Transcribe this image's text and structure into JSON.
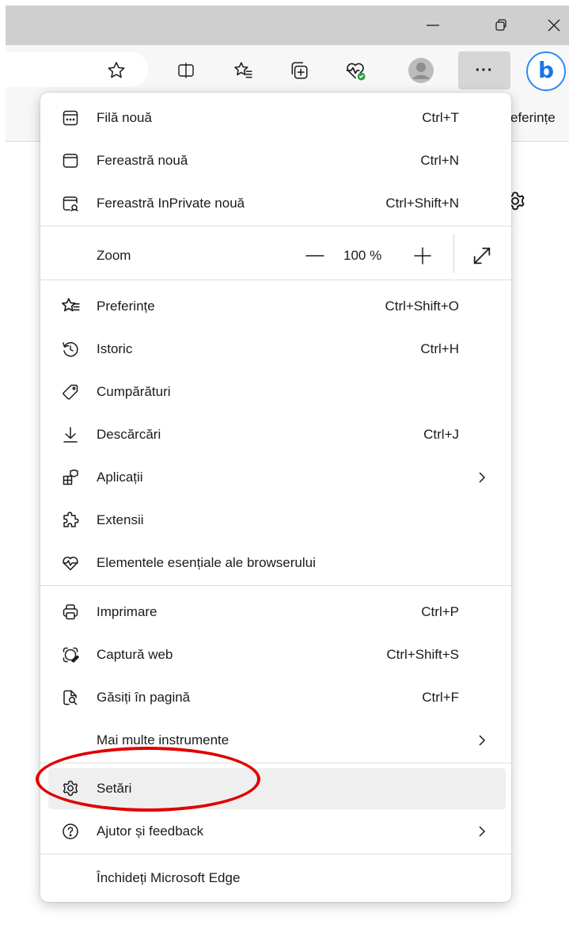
{
  "window": {
    "minimize_icon": "minimize-icon",
    "restore_icon": "restore-icon",
    "close_icon": "close-icon"
  },
  "toolbar": {
    "more_label": "···",
    "bing_label": "b",
    "favbar_partial_text": "Preferințe"
  },
  "menu": {
    "new_tab": {
      "label": "Filă nouă",
      "shortcut": "Ctrl+T",
      "icon": "new-tab-icon"
    },
    "new_window": {
      "label": "Fereastră nouă",
      "shortcut": "Ctrl+N",
      "icon": "new-window-icon"
    },
    "new_inprivate": {
      "label": "Fereastră InPrivate nouă",
      "shortcut": "Ctrl+Shift+N",
      "icon": "inprivate-icon"
    },
    "zoom": {
      "label": "Zoom",
      "value": "100 %",
      "icon": "zoom-icon"
    },
    "favorites": {
      "label": "Preferințe",
      "shortcut": "Ctrl+Shift+O",
      "icon": "favorites-icon"
    },
    "history": {
      "label": "Istoric",
      "shortcut": "Ctrl+H",
      "icon": "history-icon"
    },
    "shopping": {
      "label": "Cumpărături",
      "shortcut": "",
      "icon": "shopping-tag-icon"
    },
    "downloads": {
      "label": "Descărcări",
      "shortcut": "Ctrl+J",
      "icon": "download-icon"
    },
    "apps": {
      "label": "Aplicații",
      "shortcut": "",
      "icon": "apps-icon"
    },
    "extensions": {
      "label": "Extensii",
      "shortcut": "",
      "icon": "extensions-icon"
    },
    "essentials": {
      "label": "Elementele esențiale ale browserului",
      "shortcut": "",
      "icon": "browser-essentials-icon"
    },
    "print": {
      "label": "Imprimare",
      "shortcut": "Ctrl+P",
      "icon": "print-icon"
    },
    "web_capture": {
      "label": "Captură web",
      "shortcut": "Ctrl+Shift+S",
      "icon": "web-capture-icon"
    },
    "find": {
      "label": "Găsiți în pagină",
      "shortcut": "Ctrl+F",
      "icon": "find-in-page-icon"
    },
    "more_tools": {
      "label": "Mai multe instrumente",
      "shortcut": "",
      "icon": ""
    },
    "settings": {
      "label": "Setări",
      "shortcut": "",
      "icon": "settings-icon"
    },
    "help": {
      "label": "Ajutor și feedback",
      "shortcut": "",
      "icon": "help-icon"
    },
    "close_edge": {
      "label": "Închideți Microsoft Edge",
      "shortcut": "",
      "icon": ""
    }
  },
  "annotation": {
    "color": "#e00000",
    "target": "settings"
  }
}
